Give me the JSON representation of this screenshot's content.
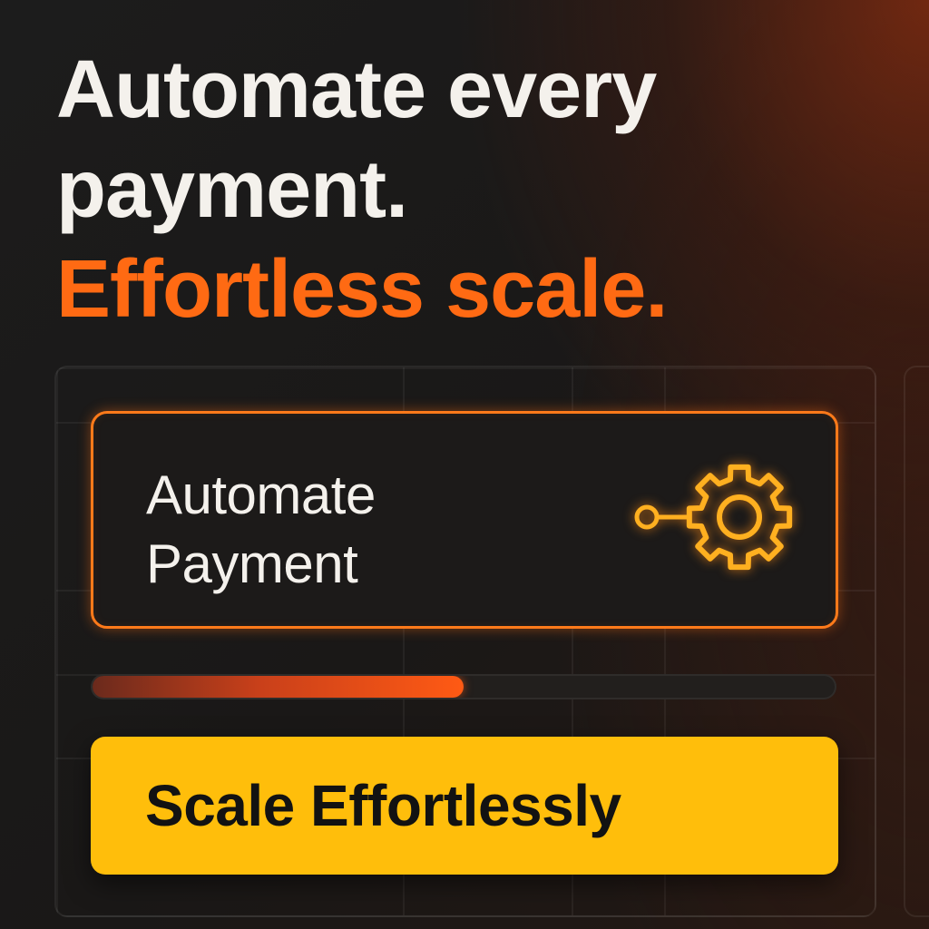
{
  "headline": {
    "line1": "Automate every",
    "line2": "payment.",
    "line3": "Effortless scale."
  },
  "card": {
    "title_line1": "Automate",
    "title_line2": "Payment",
    "icon": "gear-with-connector-icon"
  },
  "progress": {
    "value": 0.5
  },
  "cta": {
    "label": "Scale Effortlessly"
  },
  "colors": {
    "background": "#1c1c1c",
    "accent_orange": "#ff6a13",
    "card_border": "#ff7a1a",
    "gear": "#ffb020",
    "cta_yellow": "#ffbe0b",
    "text_light": "#f4f1ec",
    "text_dark": "#121212"
  }
}
